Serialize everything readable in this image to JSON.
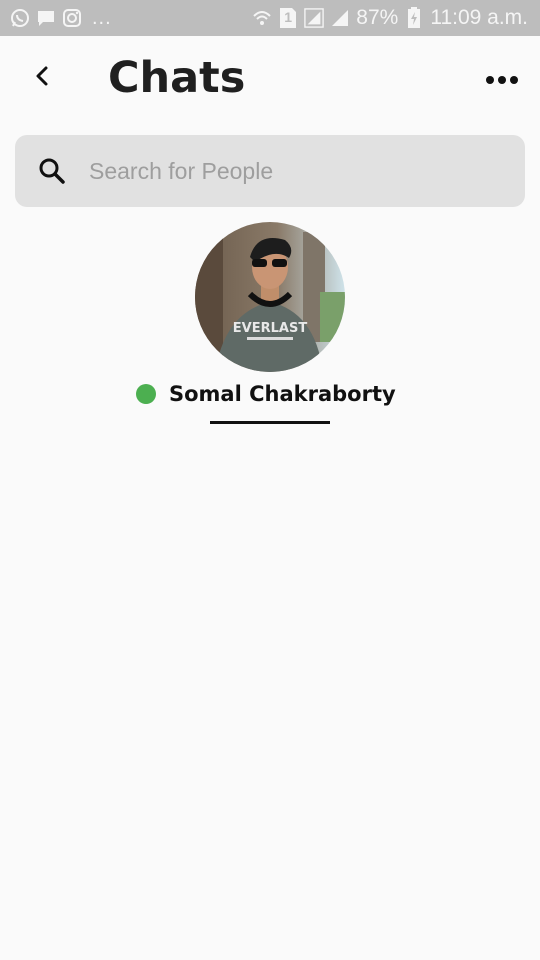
{
  "status_bar": {
    "battery": "87%",
    "time": "11:09 a.m.",
    "dots": "...",
    "sim_label": "1",
    "left_icons": [
      "whatsapp-icon",
      "message-icon",
      "instagram-icon"
    ],
    "right_icons": [
      "wifi-icon",
      "sim-icon",
      "signal-icon",
      "signal-icon",
      "battery-charging-icon"
    ]
  },
  "header": {
    "title": "Chats",
    "back_icon": "chevron-left-icon",
    "more_icon": "more-horizontal-icon"
  },
  "search": {
    "placeholder": "Search for People",
    "value": "",
    "icon": "search-icon"
  },
  "people": [
    {
      "name": "Somal Chakraborty",
      "status": "online",
      "status_color": "#4caf50",
      "avatar_shirt_text": "EVERLAST"
    }
  ],
  "colors": {
    "status_bar_bg": "#bdbdbd",
    "background": "#fafafa",
    "search_bg": "#e1e1e1",
    "online": "#4caf50",
    "title": "#202020"
  }
}
